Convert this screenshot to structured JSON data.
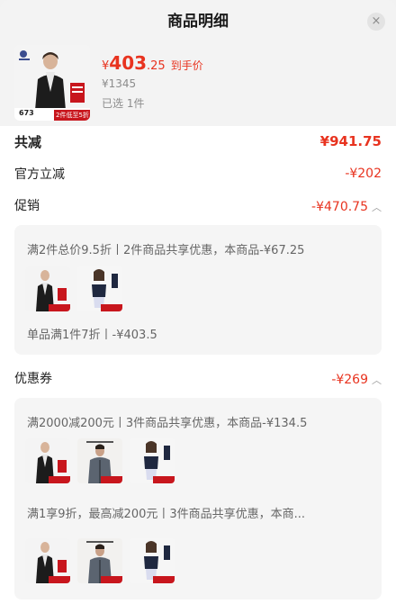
{
  "header": {
    "title": "商品明细",
    "close_icon": "×"
  },
  "product": {
    "currency": "¥",
    "price_int": "403",
    "price_dec": ".25",
    "price_tag": "到手价",
    "original_price": "¥1345",
    "selected": "已选 1件",
    "thumb_promo": "2件低至5折",
    "thumb_price": "673"
  },
  "summary": {
    "total_label": "共减",
    "total_value": "¥941.75",
    "official_label": "官方立减",
    "official_value": "-¥202",
    "promo_label": "促销",
    "promo_value": "-¥470.75",
    "coupon_label": "优惠券",
    "coupon_value": "-¥269"
  },
  "promo_card": {
    "rule1": "满2件总价9.5折丨2件商品共享优惠，本商品-¥67.25",
    "rule2": "单品满1件7折丨-¥403.5"
  },
  "coupon_card": {
    "rule1": "满2000减200元丨3件商品共享优惠，本商品-¥134.5",
    "rule2": "满1享9折，最高减200元丨3件商品共享优惠，本商..."
  },
  "colors": {
    "accent": "#e8331f",
    "muted": "#8c8c8c"
  }
}
